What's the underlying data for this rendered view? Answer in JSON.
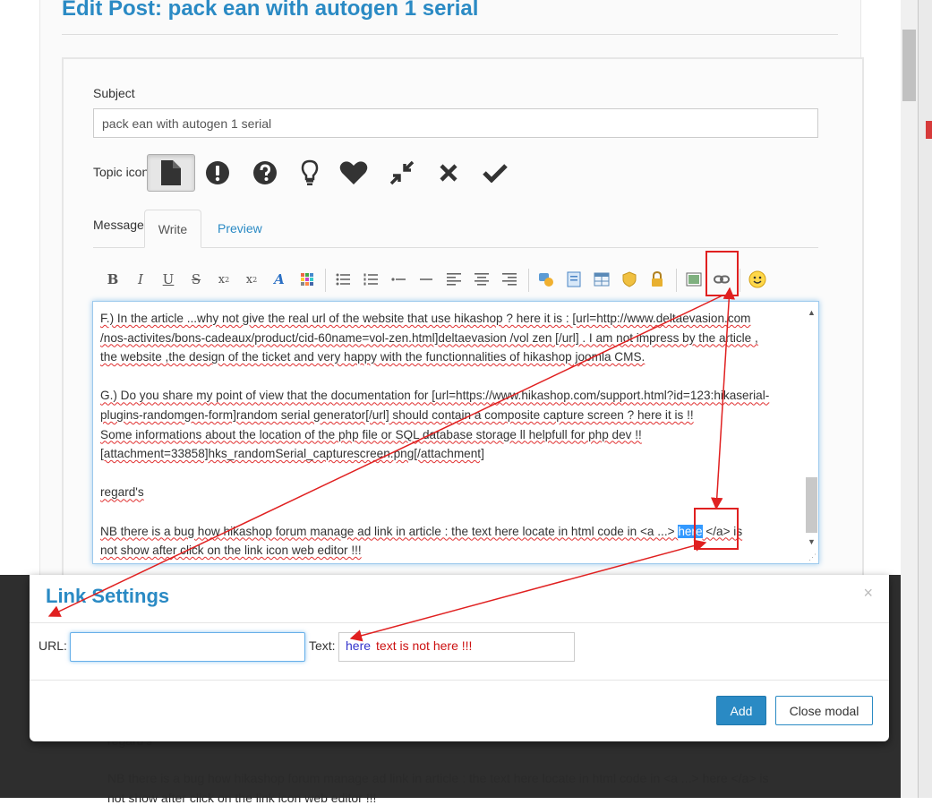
{
  "page": {
    "title": "Edit Post: pack ean with autogen 1 serial"
  },
  "subject": {
    "label": "Subject",
    "value": "pack ean with autogen 1 serial"
  },
  "topic_icon": {
    "label": "Topic icon",
    "icons": [
      "file-icon",
      "exclamation-icon",
      "question-icon",
      "lightbulb-icon",
      "heart-icon",
      "compress-icon",
      "times-icon",
      "check-icon"
    ],
    "selected": "file-icon"
  },
  "message": {
    "label": "Message",
    "tabs": {
      "write": "Write",
      "preview": "Preview"
    },
    "toolbar": [
      "bold",
      "italic",
      "underline",
      "strikethrough",
      "subscript",
      "superscript",
      "text-color",
      "emoticons-grid",
      "bullet-list",
      "numbered-list",
      "list-item",
      "horizontal-rule",
      "align-left",
      "align-center",
      "align-right",
      "quote",
      "code",
      "table",
      "spoiler",
      "hidden-content",
      "image",
      "link",
      "emoji"
    ],
    "editor": {
      "l1": "F.) In the article ...why not give the real url of the website that use hikashop ? here it is : [url=http://www.deltaevasion.com",
      "l2": "/nos-activites/bons-cadeaux/product/cid-60name=vol-zen.html]deltaevasion /vol zen [/url] . I am  not impress by the article ,",
      "l3": "the website ,the design of the ticket and very happy  with the functionnalities of hikashop joomla CMS.",
      "l4": "G.) Do you share my point of view that the documentation for [url=https://www.hikashop.com/support.html?id=123:hikaserial-",
      "l5": "plugins-randomgen-form]random serial generator[/url] should contain a composite capture  screen  ?  here it is !!",
      "l6": "Some informations about the location of the php file or SQL database storage ll helpfull for php dev  !!",
      "l7": " [attachment=33858]hks_randomSerial_capturescreen.png[/attachment]",
      "l8": "regard's",
      "l9a": "NB there is a bug how hikashop forum manage ad link in article : the text  here locate in html code in <a ...> ",
      "l9hl": "here",
      "l9b": " </a>  is",
      "l10": "not show after click on the link icon web editor  !!!"
    }
  },
  "background_text": {
    "regards": "regard's",
    "nb1": "NB there is a bug how hikashop forum manage ad link in article : the text  here locate in html code in <a ...> here </a>  is",
    "nb2": "not show after click on the link icon web editor  !!!"
  },
  "modal": {
    "title": "Link Settings",
    "close_symbol": "×",
    "url_label": "URL:",
    "url_value": "",
    "text_label": "Text:",
    "text_value": "here",
    "annotation_note": "text is not here !!!",
    "add_label": "Add",
    "close_label": "Close modal"
  },
  "colors": {
    "accent": "#2a8ac4",
    "annotation": "#e02020",
    "highlight": "#3399ff"
  }
}
